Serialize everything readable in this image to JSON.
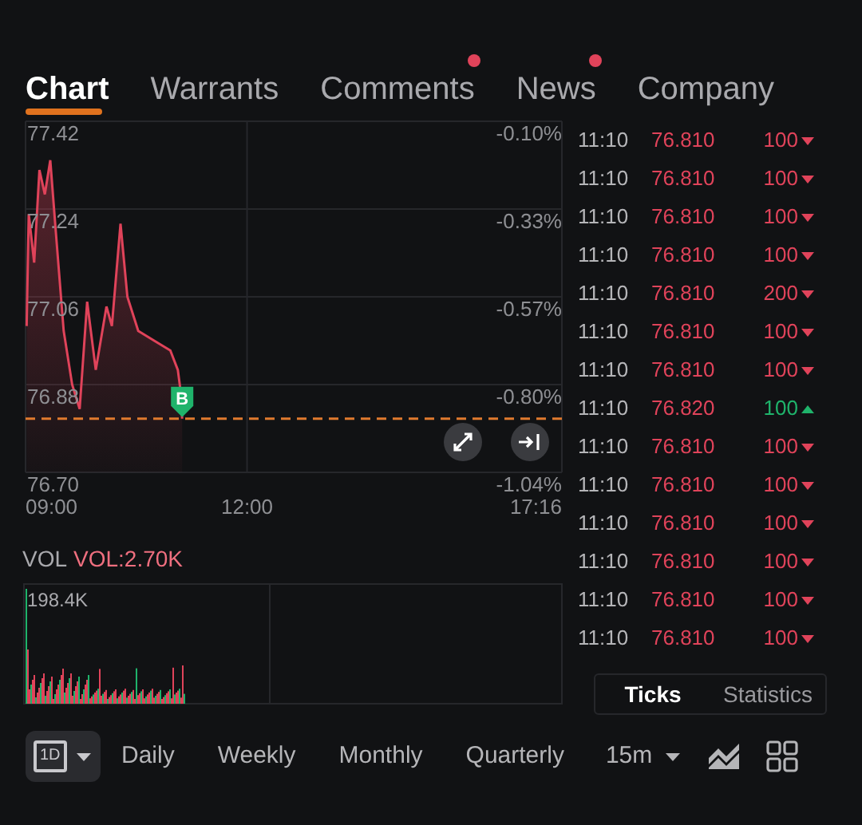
{
  "tabs": [
    {
      "label": "Chart",
      "selected": true,
      "dot": false
    },
    {
      "label": "Warrants",
      "selected": false,
      "dot": false
    },
    {
      "label": "Comments",
      "selected": false,
      "dot": true
    },
    {
      "label": "News",
      "selected": false,
      "dot": true
    },
    {
      "label": "Company",
      "selected": false,
      "dot": false
    }
  ],
  "price_chart": {
    "price_labels": [
      "77.42",
      "77.24",
      "77.06",
      "76.88",
      "76.70"
    ],
    "time_labels": [
      "09:00",
      "12:00",
      "17:16"
    ],
    "percent_labels": [
      "-0.10%",
      "-0.33%",
      "-0.57%",
      "-0.80%",
      "-1.04%"
    ],
    "marker": {
      "label": "B"
    }
  },
  "volume": {
    "label": "VOL",
    "value": "VOL:2.70K",
    "max_label": "198.4K"
  },
  "ticks": [
    {
      "time": "11:10",
      "price": "76.810",
      "size": "100",
      "up": false
    },
    {
      "time": "11:10",
      "price": "76.810",
      "size": "100",
      "up": false
    },
    {
      "time": "11:10",
      "price": "76.810",
      "size": "100",
      "up": false
    },
    {
      "time": "11:10",
      "price": "76.810",
      "size": "100",
      "up": false
    },
    {
      "time": "11:10",
      "price": "76.810",
      "size": "200",
      "up": false
    },
    {
      "time": "11:10",
      "price": "76.810",
      "size": "100",
      "up": false
    },
    {
      "time": "11:10",
      "price": "76.810",
      "size": "100",
      "up": false
    },
    {
      "time": "11:10",
      "price": "76.820",
      "size": "100",
      "up": true
    },
    {
      "time": "11:10",
      "price": "76.810",
      "size": "100",
      "up": false
    },
    {
      "time": "11:10",
      "price": "76.810",
      "size": "100",
      "up": false
    },
    {
      "time": "11:10",
      "price": "76.810",
      "size": "100",
      "up": false
    },
    {
      "time": "11:10",
      "price": "76.810",
      "size": "100",
      "up": false
    },
    {
      "time": "11:10",
      "price": "76.810",
      "size": "100",
      "up": false
    },
    {
      "time": "11:10",
      "price": "76.810",
      "size": "100",
      "up": false
    }
  ],
  "ticks_tabs": [
    {
      "label": "Ticks",
      "selected": true
    },
    {
      "label": "Statistics",
      "selected": false
    }
  ],
  "toolbar": {
    "range_button": "1D",
    "periods": [
      "Daily",
      "Weekly",
      "Monthly",
      "Quarterly"
    ],
    "interval": "15m"
  }
}
